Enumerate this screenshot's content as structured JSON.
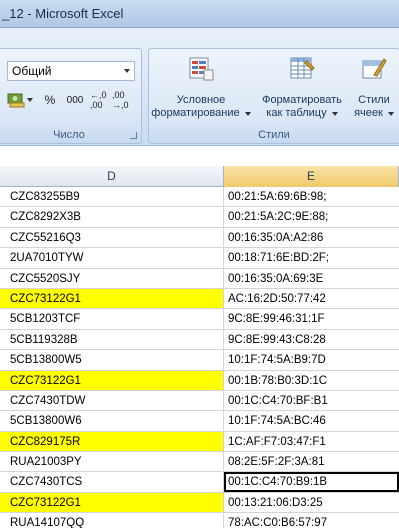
{
  "window": {
    "title": "_12 - Microsoft Excel"
  },
  "ribbon": {
    "number_group": {
      "label": "Число",
      "format_value": "Общий",
      "percent_label": "%",
      "thousands_label": "000",
      "increase_decimal_label": "←,0 ,00",
      "decrease_decimal_label": ",00 →,0"
    },
    "styles_group": {
      "label": "Стили",
      "conditional_formatting": [
        "Условное",
        "форматирование"
      ],
      "format_as_table": [
        "Форматировать",
        "как таблицу"
      ],
      "cell_styles": [
        "Стили",
        "ячеек"
      ]
    }
  },
  "grid": {
    "columns": [
      "D",
      "E"
    ],
    "highlight_color": "#ffff00",
    "rows": [
      {
        "d": "CZC83255B9",
        "e": "00:21:5A:69:6B:98;",
        "highlight": false
      },
      {
        "d": "CZC8292X3B",
        "e": "00:21:5A:2C:9E:88;",
        "highlight": false
      },
      {
        "d": "CZC55216Q3",
        "e": "00:16:35:0A:A2:86",
        "highlight": false
      },
      {
        "d": "2UA7010TYW",
        "e": "00:18:71:6E:BD:2F;",
        "highlight": false
      },
      {
        "d": "CZC5520SJY",
        "e": "00:16:35:0A:69:3E",
        "highlight": false
      },
      {
        "d": "CZC73122G1",
        "e": "AC:16:2D:50:77:42",
        "highlight": true
      },
      {
        "d": "5CB1203TCF",
        "e": "9C:8E:99:46:31:1F",
        "highlight": false
      },
      {
        "d": "5CB119328B",
        "e": "9C:8E:99:43:C8:28",
        "highlight": false
      },
      {
        "d": "5CB13800W5",
        "e": "10:1F:74:5A:B9:7D",
        "highlight": false
      },
      {
        "d": "CZC73122G1",
        "e": "00:1B:78:B0:3D:1C",
        "highlight": true
      },
      {
        "d": "CZC7430TDW",
        "e": "00:1C:C4:70:BF:B1",
        "highlight": false
      },
      {
        "d": "5CB13800W6",
        "e": "10:1F:74:5A:BC:46",
        "highlight": false
      },
      {
        "d": "CZC829175R",
        "e": "1C:AF:F7:03:47:F1",
        "highlight": true
      },
      {
        "d": "RUA21003PY",
        "e": "08:2E:5F:2F:3A:81",
        "highlight": false
      },
      {
        "d": "CZC7430TCS",
        "e": "00:1C:C4:70:B9:1B",
        "highlight": false,
        "active": true
      },
      {
        "d": "CZC73122G1",
        "e": "00:13:21:06:D3:25",
        "highlight": true
      },
      {
        "d": "RUA14107QQ",
        "e": "78:AC:C0:B6:57:97",
        "highlight": false
      }
    ]
  }
}
